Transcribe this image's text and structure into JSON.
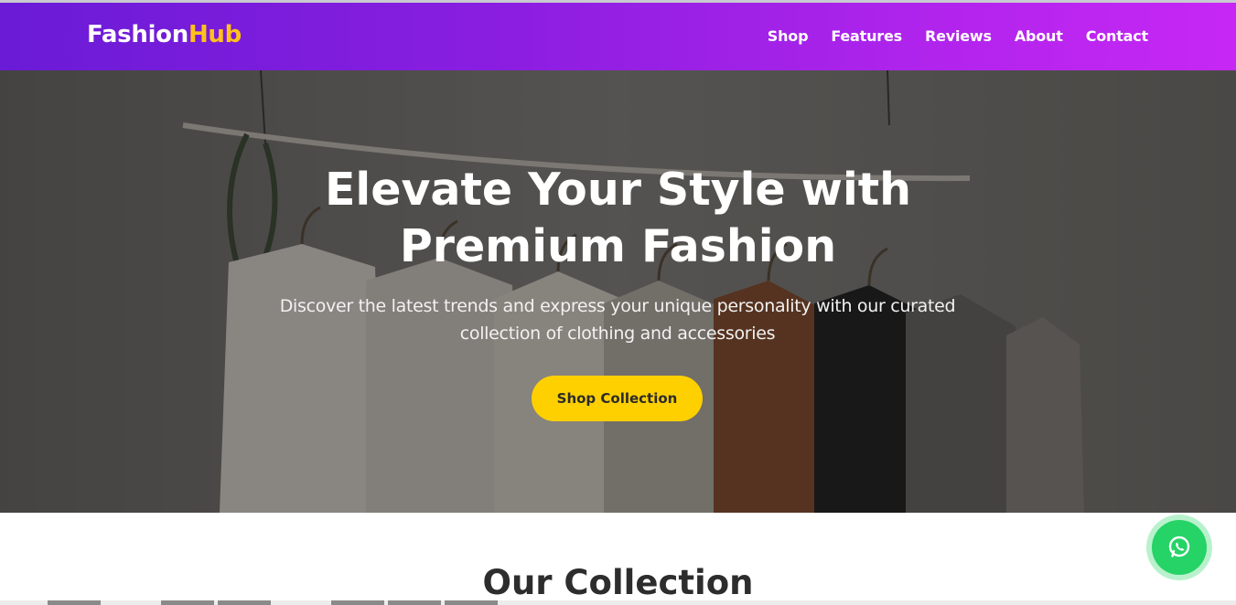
{
  "brand": {
    "part1": "Fashion",
    "part2": "Hub"
  },
  "nav": [
    {
      "label": "Shop"
    },
    {
      "label": "Features"
    },
    {
      "label": "Reviews"
    },
    {
      "label": "About"
    },
    {
      "label": "Contact"
    }
  ],
  "hero": {
    "title_line1": "Elevate Your Style with",
    "title_line2": "Premium Fashion",
    "subtitle": "Discover the latest trends and express your unique personality with our curated collection of clothing and accessories",
    "cta": "Shop Collection"
  },
  "collection": {
    "title": "Our Collection"
  },
  "floating": {
    "icon": "whatsapp-icon"
  },
  "colors": {
    "nav_gradient_start": "#6a1bd6",
    "nav_gradient_end": "#c727f4",
    "accent": "#ffc21a",
    "cta": "#ffd000",
    "whatsapp": "#25d366"
  }
}
